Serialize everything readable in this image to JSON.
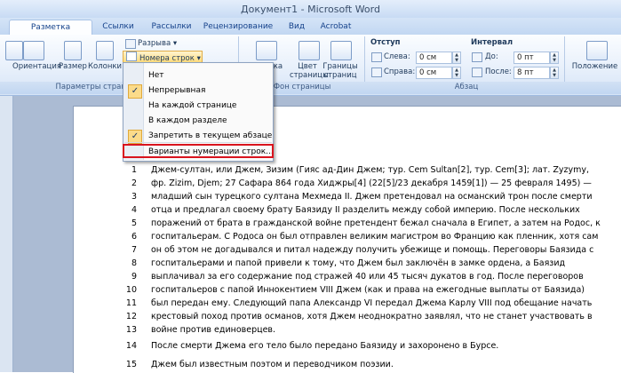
{
  "window": {
    "title": "Документ1 - Microsoft Word"
  },
  "tabs": [
    "Разметка страницы",
    "Ссылки",
    "Рассылки",
    "Рецензирование",
    "Вид",
    "Acrobat"
  ],
  "ribbon": {
    "breaks_label": "Разрыва",
    "line_numbers_label": "Номера строк",
    "orientation_label": "Ориентация",
    "size_label": "Размер",
    "columns_label": "Колонки",
    "watermark_label": "Подложка",
    "page_color_label1": "Цвет",
    "page_color_label2": "страницы",
    "page_borders_label1": "Границы",
    "page_borders_label2": "страниц",
    "position_label": "Положение",
    "indent_header": "Отступ",
    "indent_left_label": "Слева:",
    "indent_left_value": "0 см",
    "indent_right_label": "Справа:",
    "indent_right_value": "0 см",
    "spacing_header": "Интервал",
    "spacing_before_label": "До:",
    "spacing_before_value": "0 пт",
    "spacing_after_label": "После:",
    "spacing_after_value": "8 пт",
    "group_page_setup": "Параметры страни",
    "group_background": "Фон страницы",
    "group_paragraph": "Абзац"
  },
  "menu": {
    "items": [
      {
        "label": "Нет",
        "checked": false
      },
      {
        "label": "Непрерывная",
        "checked": true
      },
      {
        "label": "На каждой странице",
        "checked": false
      },
      {
        "label": "В каждом разделе",
        "checked": false
      },
      {
        "label": "Запретить в текущем абзаце",
        "checked": true
      },
      {
        "label": "Варианты нумерации строк...",
        "checked": false
      }
    ],
    "check_glyph": "✓"
  },
  "document": {
    "line_numbers": [
      "1",
      "2",
      "3",
      "4",
      "5",
      "6",
      "7",
      "8",
      "9",
      "10",
      "11",
      "12",
      "13",
      "14",
      "15"
    ],
    "lines": [
      "Джем-султан, или Джем, Зизим (Гияс ад-Дин Джем; тур. Cem Sultan[2], тур. Cem[3]; лат. Zyzymy,",
      "фр. Zizim, Djem; 27 Сафара 864  года Хиджры[4] (22[5]/23 декабря 1459[1]) — 25 февраля 1495)  —",
      "младший сын турецкого султана Мехмеда II. Джем претендовал на османский трон после смерти",
      "отца и предлагал своему брату Баязиду II разделить между собой империю. После нескольких",
      "поражений от брата в гражданской войне претендент бежал сначала в Египет, а затем на Родос, к",
      "госпитальерам. С Родоса он был отправлен великим магистром во Францию как пленник, хотя сам",
      "он об этом не догадывался и питал надежду получить убежище и помощь. Переговоры Баязида с",
      "госпитальерами и папой привели к тому, что Джем был заключён в замке ордена, а Баязид",
      "выплачивал за его содержание под стражей 40  или 45  тысяч дукатов в год. После переговоров",
      "госпитальеров с папой Иннокентием VIII Джем (как и права на ежегодные выплаты от Баязида)",
      "был передан ему. Следующий папа Александр VI передал Джема Карлу VIII под обещание начать",
      "крестовый поход против османов, хотя Джем неоднократно заявлял, что не станет участвовать в",
      "войне против единоверцев.",
      "После смерти Джема его тело было передано Баязиду и захоронено в Бурсе.",
      "Джем был известным поэтом и переводчиком поэзии."
    ]
  }
}
